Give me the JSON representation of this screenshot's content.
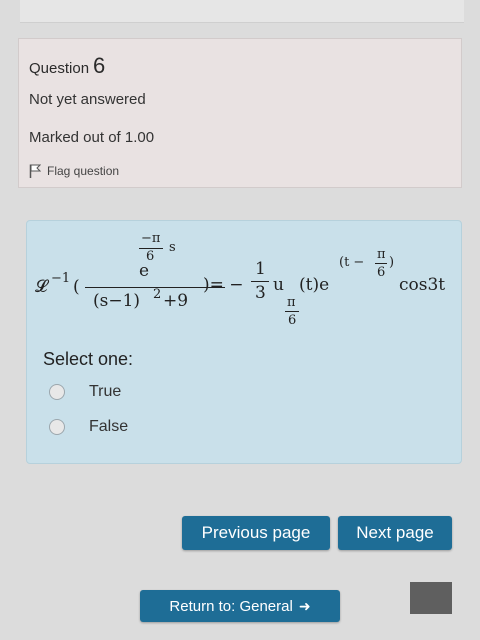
{
  "question": {
    "label": "Question",
    "number": "6",
    "state": "Not yet answered",
    "grade": "Marked out of 1.00",
    "flag_label": "Flag question"
  },
  "formula": {
    "laplace_symbol": "𝓛",
    "inverse_exp": "−1",
    "open_paren": "(",
    "exp_base": "e",
    "exp_minus_pi": "−π",
    "exp_six": "6",
    "exp_s": "s",
    "denominator": "(s−1)",
    "denominator_sq": "2",
    "denominator_plus": "+9",
    "close_eq": ")= −",
    "coef_num": "1",
    "coef_den": "3",
    "u": "u",
    "u_sub_pi": "π",
    "u_sub_six": "6",
    "t_e": "(t)e",
    "exp2_open": "(t −",
    "exp2_pi": "π",
    "exp2_six": "6",
    "exp2_close": ")",
    "cos": "cos3t"
  },
  "answer": {
    "prompt": "Select one:",
    "options": [
      "True",
      "False"
    ]
  },
  "nav": {
    "previous": "Previous page",
    "next": "Next page",
    "return_label": "Return to: General",
    "return_icon": "➜"
  },
  "icons": {
    "flag": "flag-icon",
    "return_arrow": "sign-in-arrow-icon"
  },
  "colors": {
    "panel_info": "#e9e2e2",
    "panel_question": "#c9e0ea",
    "button": "#1e6d96"
  }
}
